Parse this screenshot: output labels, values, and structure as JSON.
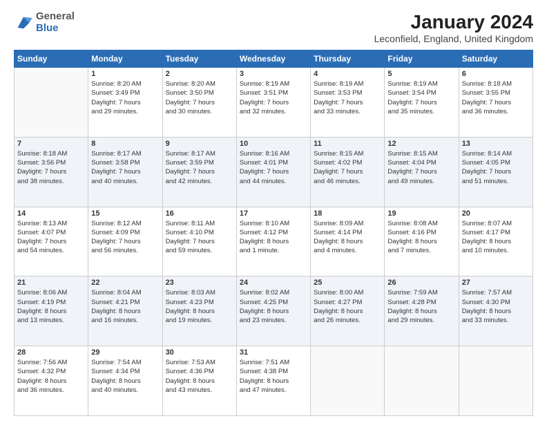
{
  "header": {
    "logo_general": "General",
    "logo_blue": "Blue",
    "title": "January 2024",
    "subtitle": "Leconfield, England, United Kingdom"
  },
  "calendar": {
    "days_header": [
      "Sunday",
      "Monday",
      "Tuesday",
      "Wednesday",
      "Thursday",
      "Friday",
      "Saturday"
    ],
    "weeks": [
      [
        {
          "num": "",
          "info": ""
        },
        {
          "num": "1",
          "info": "Sunrise: 8:20 AM\nSunset: 3:49 PM\nDaylight: 7 hours\nand 29 minutes."
        },
        {
          "num": "2",
          "info": "Sunrise: 8:20 AM\nSunset: 3:50 PM\nDaylight: 7 hours\nand 30 minutes."
        },
        {
          "num": "3",
          "info": "Sunrise: 8:19 AM\nSunset: 3:51 PM\nDaylight: 7 hours\nand 32 minutes."
        },
        {
          "num": "4",
          "info": "Sunrise: 8:19 AM\nSunset: 3:53 PM\nDaylight: 7 hours\nand 33 minutes."
        },
        {
          "num": "5",
          "info": "Sunrise: 8:19 AM\nSunset: 3:54 PM\nDaylight: 7 hours\nand 35 minutes."
        },
        {
          "num": "6",
          "info": "Sunrise: 8:18 AM\nSunset: 3:55 PM\nDaylight: 7 hours\nand 36 minutes."
        }
      ],
      [
        {
          "num": "7",
          "info": "Sunrise: 8:18 AM\nSunset: 3:56 PM\nDaylight: 7 hours\nand 38 minutes."
        },
        {
          "num": "8",
          "info": "Sunrise: 8:17 AM\nSunset: 3:58 PM\nDaylight: 7 hours\nand 40 minutes."
        },
        {
          "num": "9",
          "info": "Sunrise: 8:17 AM\nSunset: 3:59 PM\nDaylight: 7 hours\nand 42 minutes."
        },
        {
          "num": "10",
          "info": "Sunrise: 8:16 AM\nSunset: 4:01 PM\nDaylight: 7 hours\nand 44 minutes."
        },
        {
          "num": "11",
          "info": "Sunrise: 8:15 AM\nSunset: 4:02 PM\nDaylight: 7 hours\nand 46 minutes."
        },
        {
          "num": "12",
          "info": "Sunrise: 8:15 AM\nSunset: 4:04 PM\nDaylight: 7 hours\nand 49 minutes."
        },
        {
          "num": "13",
          "info": "Sunrise: 8:14 AM\nSunset: 4:05 PM\nDaylight: 7 hours\nand 51 minutes."
        }
      ],
      [
        {
          "num": "14",
          "info": "Sunrise: 8:13 AM\nSunset: 4:07 PM\nDaylight: 7 hours\nand 54 minutes."
        },
        {
          "num": "15",
          "info": "Sunrise: 8:12 AM\nSunset: 4:09 PM\nDaylight: 7 hours\nand 56 minutes."
        },
        {
          "num": "16",
          "info": "Sunrise: 8:11 AM\nSunset: 4:10 PM\nDaylight: 7 hours\nand 59 minutes."
        },
        {
          "num": "17",
          "info": "Sunrise: 8:10 AM\nSunset: 4:12 PM\nDaylight: 8 hours\nand 1 minute."
        },
        {
          "num": "18",
          "info": "Sunrise: 8:09 AM\nSunset: 4:14 PM\nDaylight: 8 hours\nand 4 minutes."
        },
        {
          "num": "19",
          "info": "Sunrise: 8:08 AM\nSunset: 4:16 PM\nDaylight: 8 hours\nand 7 minutes."
        },
        {
          "num": "20",
          "info": "Sunrise: 8:07 AM\nSunset: 4:17 PM\nDaylight: 8 hours\nand 10 minutes."
        }
      ],
      [
        {
          "num": "21",
          "info": "Sunrise: 8:06 AM\nSunset: 4:19 PM\nDaylight: 8 hours\nand 13 minutes."
        },
        {
          "num": "22",
          "info": "Sunrise: 8:04 AM\nSunset: 4:21 PM\nDaylight: 8 hours\nand 16 minutes."
        },
        {
          "num": "23",
          "info": "Sunrise: 8:03 AM\nSunset: 4:23 PM\nDaylight: 8 hours\nand 19 minutes."
        },
        {
          "num": "24",
          "info": "Sunrise: 8:02 AM\nSunset: 4:25 PM\nDaylight: 8 hours\nand 23 minutes."
        },
        {
          "num": "25",
          "info": "Sunrise: 8:00 AM\nSunset: 4:27 PM\nDaylight: 8 hours\nand 26 minutes."
        },
        {
          "num": "26",
          "info": "Sunrise: 7:59 AM\nSunset: 4:28 PM\nDaylight: 8 hours\nand 29 minutes."
        },
        {
          "num": "27",
          "info": "Sunrise: 7:57 AM\nSunset: 4:30 PM\nDaylight: 8 hours\nand 33 minutes."
        }
      ],
      [
        {
          "num": "28",
          "info": "Sunrise: 7:56 AM\nSunset: 4:32 PM\nDaylight: 8 hours\nand 36 minutes."
        },
        {
          "num": "29",
          "info": "Sunrise: 7:54 AM\nSunset: 4:34 PM\nDaylight: 8 hours\nand 40 minutes."
        },
        {
          "num": "30",
          "info": "Sunrise: 7:53 AM\nSunset: 4:36 PM\nDaylight: 8 hours\nand 43 minutes."
        },
        {
          "num": "31",
          "info": "Sunrise: 7:51 AM\nSunset: 4:38 PM\nDaylight: 8 hours\nand 47 minutes."
        },
        {
          "num": "",
          "info": ""
        },
        {
          "num": "",
          "info": ""
        },
        {
          "num": "",
          "info": ""
        }
      ]
    ]
  }
}
